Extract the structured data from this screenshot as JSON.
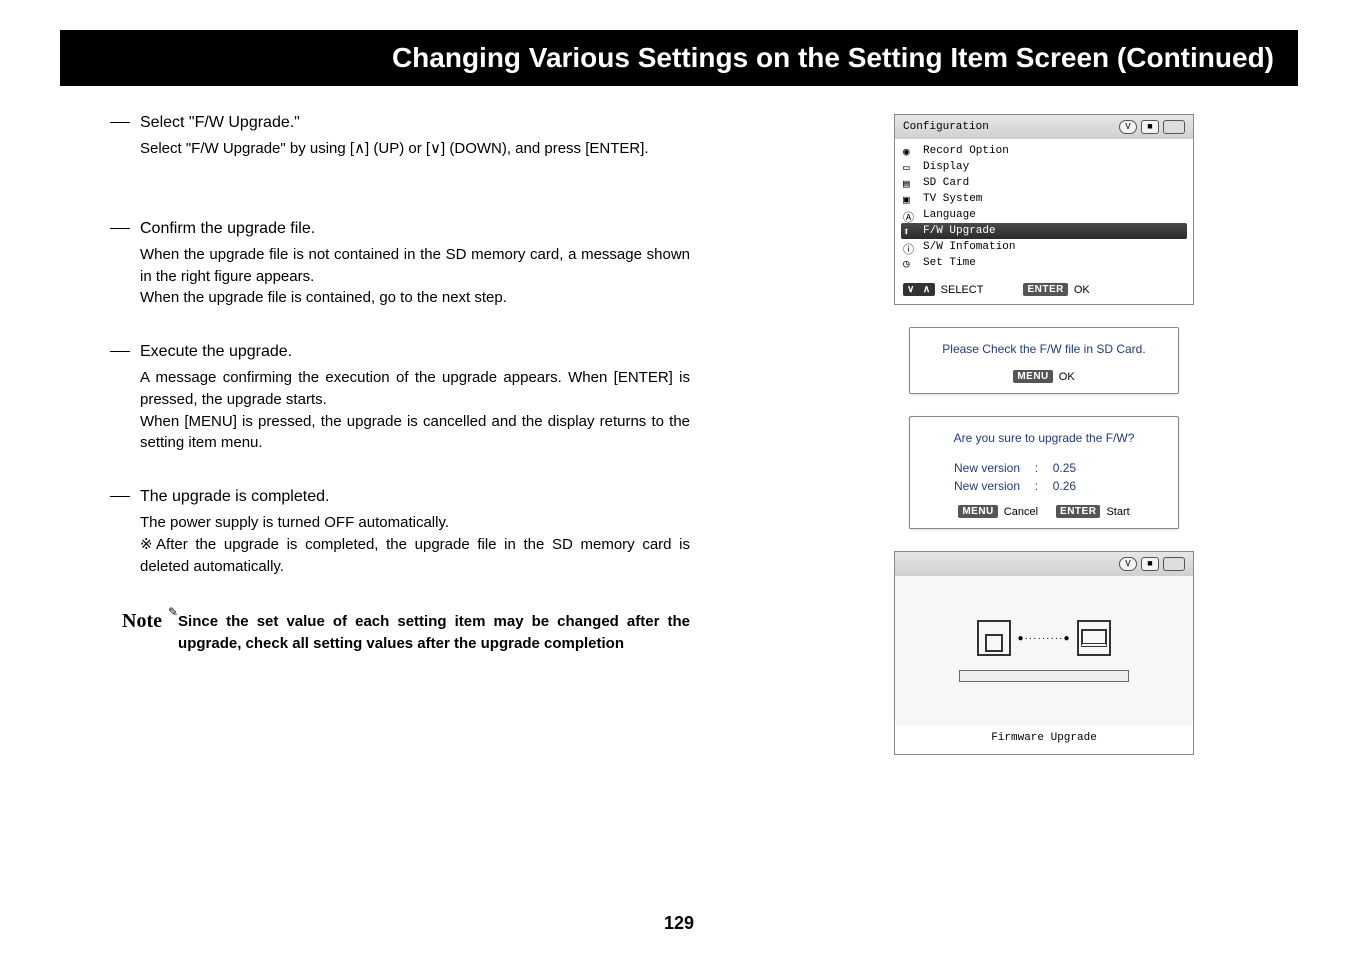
{
  "title": "Changing Various Settings on the Setting Item Screen (Continued)",
  "steps": [
    {
      "title": "Select \"F/W Upgrade.\"",
      "body": "Select \"F/W Upgrade\" by using [∧] (UP) or [∨] (DOWN), and press [ENTER]."
    },
    {
      "title": "Confirm the upgrade file.",
      "body": "When the upgrade file is not contained in the SD memory card, a message shown in the right figure appears.\nWhen the upgrade file is contained, go to the next step."
    },
    {
      "title": "Execute the upgrade.",
      "body": "A message confirming the execution of the upgrade appears. When [ENTER] is pressed, the upgrade starts.\nWhen [MENU] is pressed, the upgrade is cancelled and the display returns to the setting item menu."
    },
    {
      "title": "The upgrade is completed.",
      "body": "The power supply is turned OFF automatically.\n※After the upgrade is completed, the upgrade file in the SD memory card is deleted automatically."
    }
  ],
  "note": {
    "label": "Note",
    "text": "Since the set value of each setting item may be changed after the upgrade, check all setting values after the upgrade completion"
  },
  "config": {
    "header": "Configuration",
    "items": [
      "Record Option",
      "Display",
      "SD Card",
      "TV System",
      "Language",
      "F/W Upgrade",
      "S/W Infomation",
      "Set Time"
    ],
    "selected_index": 5,
    "footer": {
      "select": "SELECT",
      "ok": "OK",
      "down": "∨",
      "up": "∧",
      "enter": "ENTER"
    }
  },
  "msg1": {
    "text": "Please Check the F/W file in SD Card.",
    "menu": "MENU",
    "ok": "OK"
  },
  "msg2": {
    "text": "Are you sure to upgrade the F/W?",
    "rows": [
      {
        "label": "New version",
        "sep": ":",
        "val": "0.25"
      },
      {
        "label": "New version",
        "sep": ":",
        "val": "0.26"
      }
    ],
    "menu": "MENU",
    "cancel": "Cancel",
    "enter": "ENTER",
    "start": "Start"
  },
  "upgrade": {
    "caption": "Firmware Upgrade"
  },
  "status_icon": "V",
  "page_number": "129"
}
